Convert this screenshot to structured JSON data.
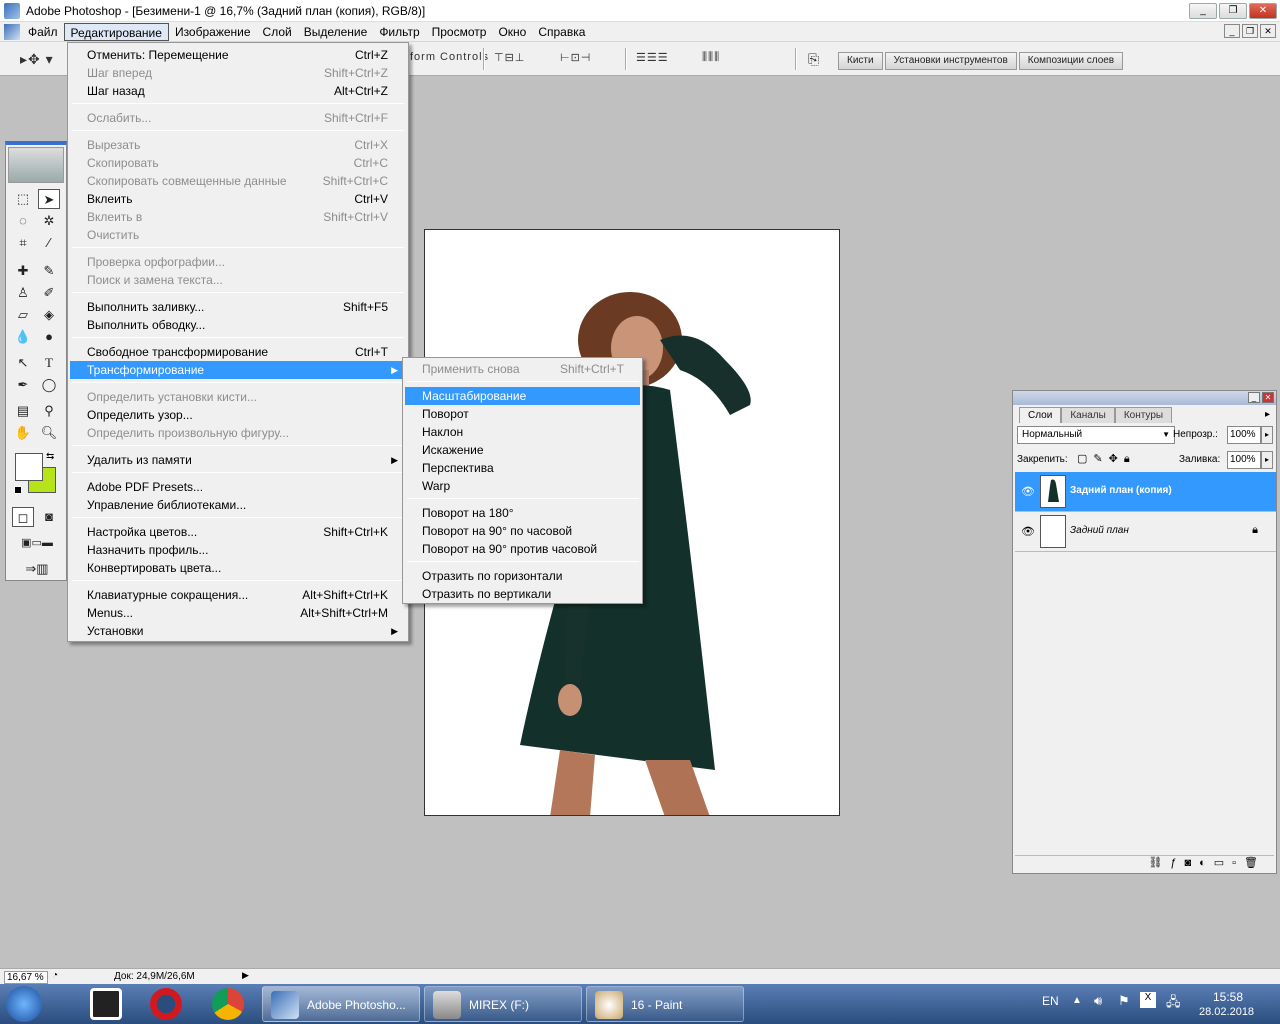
{
  "window": {
    "title": "Adobe Photoshop - [Безимени-1 @ 16,7% (Задний план (копия), RGB/8)]"
  },
  "menubar": {
    "items": [
      "Файл",
      "Редактирование",
      "Изображение",
      "Слой",
      "Выделение",
      "Фильтр",
      "Просмотр",
      "Окно",
      "Справка"
    ]
  },
  "options_bar": {
    "transform_controls_label": "form Controls",
    "wells": [
      "Кисти",
      "Установки инструментов",
      "Композиции слоев"
    ]
  },
  "edit_menu": {
    "items": [
      {
        "label": "Отменить: Перемещение",
        "shortcut": "Ctrl+Z"
      },
      {
        "label": "Шаг вперед",
        "shortcut": "Shift+Ctrl+Z"
      },
      {
        "label": "Шаг назад",
        "shortcut": "Alt+Ctrl+Z"
      },
      {
        "label": "Ослабить...",
        "shortcut": "Shift+Ctrl+F"
      },
      {
        "label": "Вырезать",
        "shortcut": "Ctrl+X"
      },
      {
        "label": "Скопировать",
        "shortcut": "Ctrl+C"
      },
      {
        "label": "Скопировать совмещенные данные",
        "shortcut": "Shift+Ctrl+C"
      },
      {
        "label": "Вклеить",
        "shortcut": "Ctrl+V"
      },
      {
        "label": "Вклеить в",
        "shortcut": "Shift+Ctrl+V"
      },
      {
        "label": "Очистить",
        "shortcut": ""
      },
      {
        "label": "Проверка орфографии...",
        "shortcut": ""
      },
      {
        "label": "Поиск и замена текста...",
        "shortcut": ""
      },
      {
        "label": "Выполнить заливку...",
        "shortcut": "Shift+F5"
      },
      {
        "label": "Выполнить обводку...",
        "shortcut": ""
      },
      {
        "label": "Свободное трансформирование",
        "shortcut": "Ctrl+T"
      },
      {
        "label": "Трансформирование",
        "shortcut": ""
      },
      {
        "label": "Определить установки кисти...",
        "shortcut": ""
      },
      {
        "label": "Определить узор...",
        "shortcut": ""
      },
      {
        "label": "Определить произвольную фигуру...",
        "shortcut": ""
      },
      {
        "label": "Удалить из памяти",
        "shortcut": ""
      },
      {
        "label": "Adobe PDF Presets...",
        "shortcut": ""
      },
      {
        "label": "Управление библиотеками...",
        "shortcut": ""
      },
      {
        "label": "Настройка цветов...",
        "shortcut": "Shift+Ctrl+K"
      },
      {
        "label": "Назначить профиль...",
        "shortcut": ""
      },
      {
        "label": "Конвертировать цвета...",
        "shortcut": ""
      },
      {
        "label": "Клавиатурные сокращения...",
        "shortcut": "Alt+Shift+Ctrl+K"
      },
      {
        "label": "Menus...",
        "shortcut": "Alt+Shift+Ctrl+M"
      },
      {
        "label": "Установки",
        "shortcut": ""
      }
    ]
  },
  "transform_submenu": {
    "items": [
      {
        "label": "Применить снова",
        "shortcut": "Shift+Ctrl+T"
      },
      {
        "label": "Масштабирование",
        "shortcut": ""
      },
      {
        "label": "Поворот",
        "shortcut": ""
      },
      {
        "label": "Наклон",
        "shortcut": ""
      },
      {
        "label": "Искажение",
        "shortcut": ""
      },
      {
        "label": "Перспектива",
        "shortcut": ""
      },
      {
        "label": "Warp",
        "shortcut": ""
      },
      {
        "label": "Поворот на 180°",
        "shortcut": ""
      },
      {
        "label": "Поворот на 90° по часовой",
        "shortcut": ""
      },
      {
        "label": "Поворот на 90° против часовой",
        "shortcut": ""
      },
      {
        "label": "Отразить по горизонтали",
        "shortcut": ""
      },
      {
        "label": "Отразить по вертикали",
        "shortcut": ""
      }
    ]
  },
  "layers_panel": {
    "tabs": [
      "Слои",
      "Каналы",
      "Контуры"
    ],
    "blend_mode": "Нормальный",
    "opacity_label": "Непрозр.:",
    "opacity_value": "100%",
    "lock_label": "Закрепить:",
    "fill_label": "Заливка:",
    "fill_value": "100%",
    "layers": [
      {
        "name": "Задний план (копия)"
      },
      {
        "name": "Задний план"
      }
    ]
  },
  "status_bar": {
    "zoom": "16,67 %",
    "doc": "Док: 24,9M/26,6M"
  },
  "taskbar": {
    "buttons": [
      {
        "label": "Adobe Photosho..."
      },
      {
        "label": "MIREX (F:)"
      },
      {
        "label": "16 - Paint"
      }
    ],
    "language": "EN",
    "time": "15:58",
    "date": "28.02.2018"
  },
  "colors": {
    "highlight": "#3399ff",
    "foreground_swatch": "#ffffff",
    "background_swatch": "#b7e31a"
  }
}
